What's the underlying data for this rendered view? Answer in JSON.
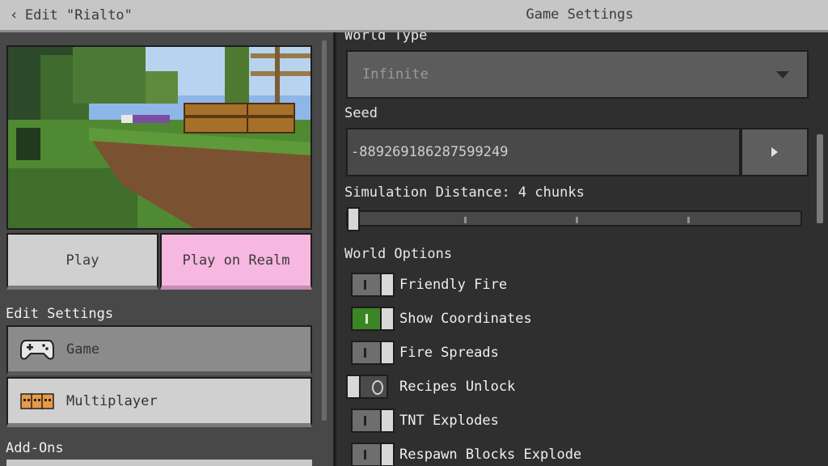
{
  "topbar": {
    "back_label": "Edit \"Rialto\"",
    "title": "Game Settings"
  },
  "left": {
    "play_label": "Play",
    "realm_label": "Play on Realm",
    "edit_settings_header": "Edit Settings",
    "nav": [
      {
        "label": "Game",
        "icon": "gamepad-icon"
      },
      {
        "label": "Multiplayer",
        "icon": "players-icon"
      }
    ],
    "addons_header": "Add-Ons"
  },
  "right": {
    "world_type_label": "World Type",
    "world_type_value": "Infinite",
    "seed_label": "Seed",
    "seed_value": "-889269186287599249",
    "simulation_label": "Simulation Distance: 4 chunks",
    "simulation_fraction": 0.0,
    "world_options_header": "World Options",
    "options": [
      {
        "label": "Friendly Fire",
        "state": "on-unset"
      },
      {
        "label": "Show Coordinates",
        "state": "on"
      },
      {
        "label": "Fire Spreads",
        "state": "on-unset"
      },
      {
        "label": "Recipes Unlock",
        "state": "off"
      },
      {
        "label": "TNT Explodes",
        "state": "on-unset"
      },
      {
        "label": "Respawn Blocks Explode",
        "state": "on-unset"
      }
    ]
  },
  "colors": {
    "topbar": "#c6c6c6",
    "panel_left": "#484848",
    "panel_right": "#2f2f2f",
    "realm_pink": "#f6b7e1",
    "toggle_on": "#3c8527"
  }
}
